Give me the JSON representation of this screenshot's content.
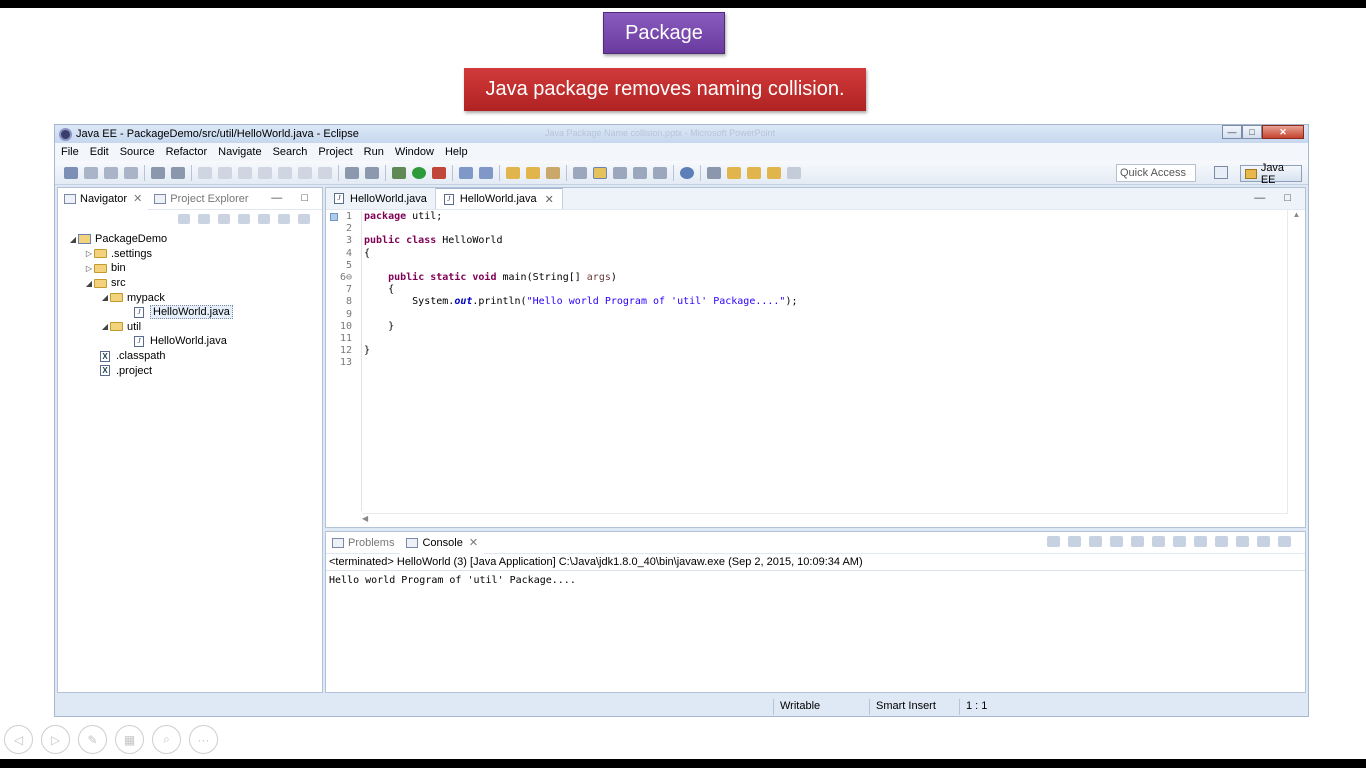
{
  "slide": {
    "title": "Package",
    "subtitle": "Java package removes naming collision."
  },
  "window": {
    "title": "Java EE - PackageDemo/src/util/HelloWorld.java - Eclipse",
    "ghost_title": "Java Package Name collision.pptx - Microsoft PowerPoint",
    "min_label": "—",
    "max_label": "□",
    "close_label": "✕"
  },
  "menu": [
    "File",
    "Edit",
    "Source",
    "Refactor",
    "Navigate",
    "Search",
    "Project",
    "Run",
    "Window",
    "Help"
  ],
  "toolbar": {
    "quick_access": "Quick Access",
    "perspective": "Java EE"
  },
  "navigator": {
    "tab_label": "Navigator",
    "tab_close": "✕",
    "inactive_tab": "Project Explorer",
    "controls": "— □",
    "tree": [
      {
        "label": "PackageDemo",
        "toggle": "◢",
        "icon": "project"
      },
      {
        "label": ".settings",
        "toggle": "▷",
        "icon": "folder"
      },
      {
        "label": "bin",
        "toggle": "▷",
        "icon": "folder"
      },
      {
        "label": "src",
        "toggle": "◢",
        "icon": "folder"
      },
      {
        "label": "mypack",
        "toggle": "◢",
        "icon": "folder"
      },
      {
        "label": "HelloWorld.java",
        "toggle": "",
        "icon": "java"
      },
      {
        "label": "util",
        "toggle": "◢",
        "icon": "folder"
      },
      {
        "label": "HelloWorld.java",
        "toggle": "",
        "icon": "java"
      },
      {
        "label": ".classpath",
        "toggle": "",
        "icon": "xml"
      },
      {
        "label": ".project",
        "toggle": "",
        "icon": "xml"
      }
    ]
  },
  "editor": {
    "tabs": [
      {
        "label": "HelloWorld.java"
      },
      {
        "label": "HelloWorld.java",
        "close": "✕"
      }
    ],
    "controls": "— □",
    "lines": [
      {
        "n": "1",
        "kw1": "package",
        "rest": " util;"
      },
      {
        "n": "2"
      },
      {
        "n": "3",
        "kw1": "public class",
        "rest": " HelloWorld"
      },
      {
        "n": "4",
        "rest": "{"
      },
      {
        "n": "5"
      },
      {
        "n": "6⊖",
        "pre": "    ",
        "kw1": "public static void",
        "rest": " main(String[] ",
        "param": "args",
        "post": ")"
      },
      {
        "n": "7",
        "rest": "    {"
      },
      {
        "n": "8",
        "rest": "        System.",
        "field": "out",
        "rest2": ".println(",
        "string": "\"Hello world Program of 'util' Package....\"",
        "post": ");"
      },
      {
        "n": "9"
      },
      {
        "n": "10",
        "rest": "    }"
      },
      {
        "n": "11"
      },
      {
        "n": "12",
        "rest": "}"
      },
      {
        "n": "13"
      }
    ]
  },
  "console": {
    "problems_tab": "Problems",
    "console_tab": "Console",
    "tab_close": "✕",
    "status": "<terminated> HelloWorld (3) [Java Application] C:\\Java\\jdk1.8.0_40\\bin\\javaw.exe (Sep 2, 2015, 10:09:34 AM)",
    "output": "Hello world Program of 'util' Package....",
    "controls": "— □"
  },
  "statusbar": {
    "writable": "Writable",
    "insert_mode": "Smart Insert",
    "position": "1 : 1"
  },
  "slide_nav": {
    "prev": "◁",
    "next": "▷",
    "pen": "✎",
    "slides": "▦",
    "zoom": "⌕",
    "more": "···"
  }
}
